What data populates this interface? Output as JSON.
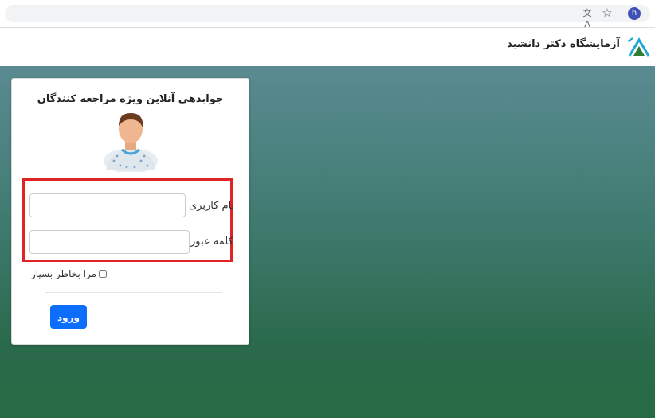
{
  "browser": {
    "profile_initial": "h",
    "translate_icon": "translate-icon",
    "bookmark_icon": "star-icon"
  },
  "site": {
    "title": "آزمایشگاه دکتر دانشبد",
    "logo_icon": "lab-logo-icon",
    "brand_color": "#1aa6d6"
  },
  "login": {
    "heading": "جوابدهی آنلاین ویژه مراجعه کنندگان",
    "username_label": "نام کاربری",
    "username_value": "",
    "password_label": "کلمه عبور",
    "password_value": "",
    "remember_label": "مرا بخاطر بسپار",
    "remember_checked": false,
    "submit_label": "ورود",
    "submit_color": "#0d6efd",
    "highlight_color": "#e02424"
  }
}
